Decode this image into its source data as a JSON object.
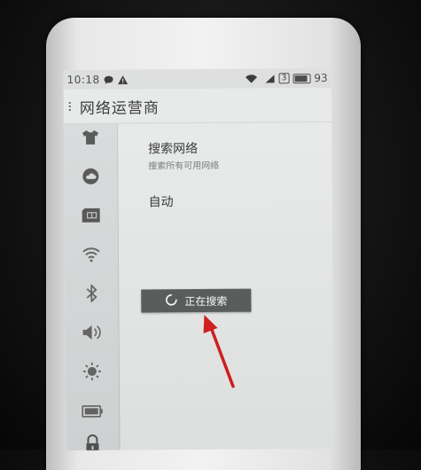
{
  "status_bar": {
    "time": "10:18",
    "icons": [
      "chat-icon",
      "warning-icon"
    ],
    "right_icons": [
      "wifi-icon",
      "signal-icon",
      "sim-icon",
      "battery-icon"
    ],
    "sim_label": "3",
    "battery_level": "93"
  },
  "header": {
    "title": "网络运营商"
  },
  "sidebar": {
    "items": [
      {
        "icon": "shirt-icon"
      },
      {
        "icon": "cloud-icon"
      },
      {
        "icon": "sim-card-icon",
        "active": true
      },
      {
        "icon": "wifi-icon"
      },
      {
        "icon": "bluetooth-icon"
      },
      {
        "icon": "volume-icon"
      },
      {
        "icon": "brightness-icon"
      },
      {
        "icon": "battery-icon"
      },
      {
        "icon": "lock-icon"
      }
    ]
  },
  "main": {
    "search_title": "搜索网络",
    "search_subtitle": "搜索所有可用网络",
    "auto_label": "自动"
  },
  "toast": {
    "label": "正在搜索"
  },
  "colors": {
    "arrow": "#d61c1c",
    "toast_bg": "#5a5c5c",
    "screen_bg": "#e9ebeb"
  }
}
